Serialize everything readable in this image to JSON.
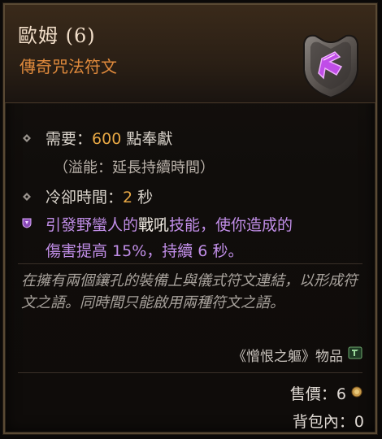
{
  "item": {
    "name": "歐姆 (6)",
    "type": "傳奇咒法符文"
  },
  "stats": {
    "requirement_label": "需要：",
    "requirement_value": "600",
    "requirement_unit": " 點奉獻",
    "overflow_note": "（溢能：延長持續時間）",
    "cooldown_label": "冷卻時間：",
    "cooldown_value": "2",
    "cooldown_unit": " 秒"
  },
  "effect": {
    "part1": "引發野蠻人的",
    "skill": "戰吼",
    "part2": "技能，使你造成的",
    "line2": "傷害提高 15%，持續 6 秒。"
  },
  "flavor": {
    "text": "在擁有兩個鑲孔的裝備上與儀式符文連結，以形成符文之語。同時間只能啟用兩種符文之語。"
  },
  "origin": {
    "text": "《憎恨之軀》物品"
  },
  "footer": {
    "price_label": "售價：6",
    "bag_label": "背包內：0"
  },
  "colors": {
    "legendary": "#e08a3c",
    "magic": "#c18ee8",
    "gold": "#e8a845"
  }
}
